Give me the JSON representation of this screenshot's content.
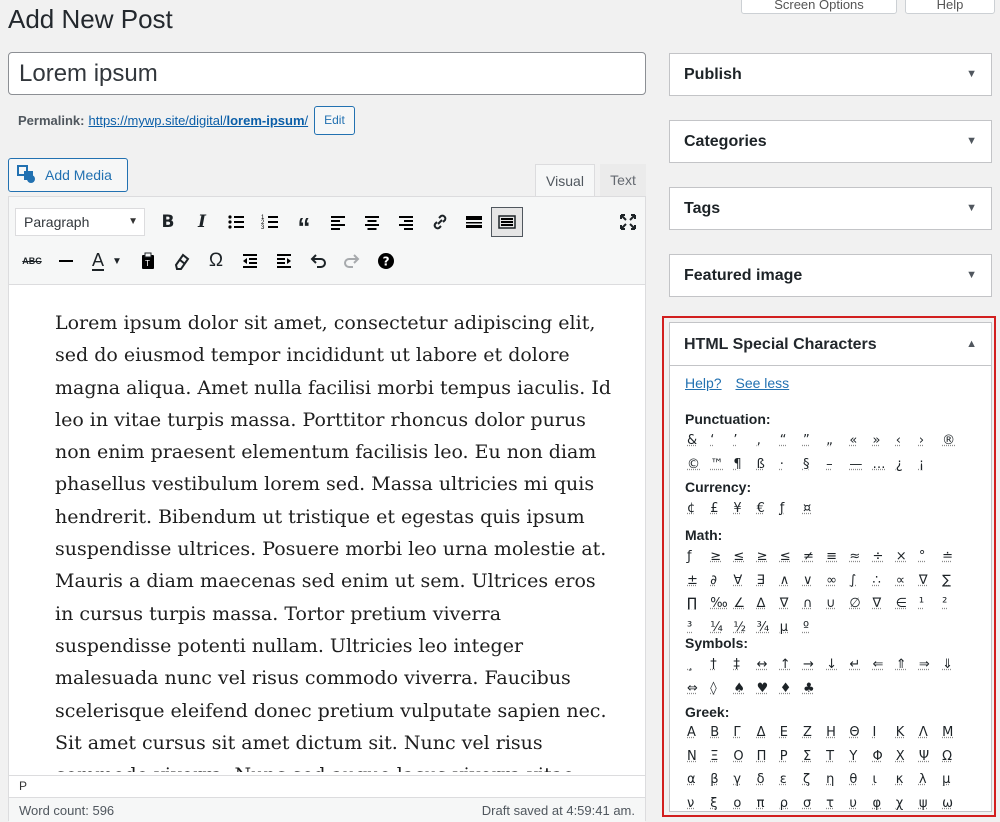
{
  "header": {
    "title": "Add New Post",
    "screen_options": "Screen Options",
    "help": "Help"
  },
  "post": {
    "title": "Lorem ipsum",
    "permalink_label": "Permalink:",
    "permalink_base": "https://mywp.site/digital/",
    "permalink_slug": "lorem-ipsum",
    "permalink_suffix": "/",
    "edit_label": "Edit"
  },
  "editor": {
    "add_media": "Add Media",
    "tab_visual": "Visual",
    "tab_text": "Text",
    "format_select": "Paragraph",
    "content": "Lorem ipsum dolor sit amet, consectetur adipiscing elit, sed do eiusmod tempor incididunt ut labore et dolore magna aliqua. Amet nulla facilisi morbi tempus iaculis. Id leo in vitae turpis massa. Porttitor rhoncus dolor purus non enim praesent elementum facilisis leo. Eu non diam phasellus vestibulum lorem sed. Massa ultricies mi quis hendrerit. Bibendum ut tristique et egestas quis ipsum suspendisse ultrices. Posuere morbi leo urna molestie at. Mauris a diam maecenas sed enim ut sem. Ultrices eros in cursus turpis massa. Tortor pretium viverra suspendisse potenti nullam. Ultricies leo integer malesuada nunc vel risus commodo viverra. Faucibus scelerisque eleifend donec pretium vulputate sapien nec. Sit amet cursus sit amet dictum sit. Nunc vel risus commodo viverra. Nunc sed augue lacus viverra vitae congue eu. Egestas erat imperdiet.",
    "path": "P",
    "word_count": "Word count: 596",
    "draft_saved": "Draft saved at 4:59:41 am."
  },
  "sidebar": {
    "publish": "Publish",
    "categories": "Categories",
    "tags": "Tags",
    "featured_image": "Featured image"
  },
  "special_chars": {
    "title": "HTML Special Characters",
    "help": "Help?",
    "see_less": "See less",
    "punctuation_label": "Punctuation:",
    "currency_label": "Currency:",
    "math_label": "Math:",
    "symbols_label": "Symbols:",
    "greek_label": "Greek:",
    "punctuation": [
      "&",
      "‘",
      "’",
      "‚",
      "“",
      "”",
      "„",
      "«",
      "»",
      "‹",
      "›",
      "®",
      "©",
      "™",
      "¶",
      "ß",
      "·",
      "§",
      "–",
      "—",
      "…",
      "¿",
      "¡"
    ],
    "currency": [
      "¢",
      "£",
      "¥",
      "€",
      "ƒ",
      "¤"
    ],
    "math": [
      "ƒ",
      "≥",
      "≤",
      "≥",
      "≤",
      "≠",
      "≡",
      "≈",
      "÷",
      "×",
      "°",
      "≐",
      "±",
      "∂",
      "∀",
      "∃",
      "∧",
      "∨",
      "∞",
      "∫",
      "∴",
      "∝",
      "∇",
      "∑",
      "∏",
      "‰",
      "∠",
      "∆",
      "∇",
      "∩",
      "∪",
      "∅",
      "∇",
      "∈",
      "¹",
      "²",
      "³",
      "¼",
      "½",
      "¾",
      "µ",
      "º"
    ],
    "symbols": [
      "¸",
      "†",
      "‡",
      "↔",
      "↑",
      "→",
      "↓",
      "↵",
      "⇐",
      "⇑",
      "⇒",
      "⇓",
      "⇔",
      "◊",
      "♠",
      "♥",
      "♦",
      "♣"
    ],
    "greek": [
      "Α",
      "Β",
      "Γ",
      "Δ",
      "Ε",
      "Ζ",
      "Η",
      "Θ",
      "Ι",
      "Κ",
      "Λ",
      "Μ",
      "Ν",
      "Ξ",
      "Ο",
      "Π",
      "Ρ",
      "Σ",
      "Τ",
      "Υ",
      "Φ",
      "Χ",
      "Ψ",
      "Ω",
      "α",
      "β",
      "γ",
      "δ",
      "ε",
      "ζ",
      "η",
      "θ",
      "ι",
      "κ",
      "λ",
      "μ",
      "ν",
      "ξ",
      "ο",
      "π",
      "ρ",
      "σ",
      "τ",
      "υ",
      "φ",
      "χ",
      "ψ",
      "ω"
    ]
  }
}
